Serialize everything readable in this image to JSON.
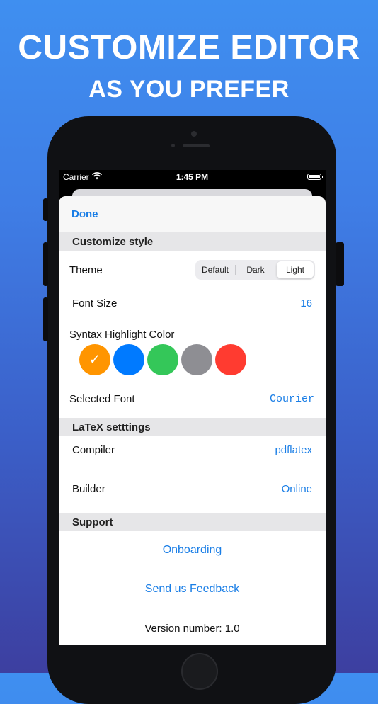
{
  "promo": {
    "headline": "CUSTOMIZE EDITOR",
    "subheadline": "AS YOU PREFER"
  },
  "status_bar": {
    "carrier": "Carrier",
    "time": "1:45 PM",
    "icons": [
      "wifi-icon",
      "battery-icon"
    ]
  },
  "navbar": {
    "done_label": "Done"
  },
  "customize_style": {
    "header": "Customize style",
    "theme": {
      "label": "Theme",
      "options": [
        "Default",
        "Dark",
        "Light"
      ],
      "selected": "Light"
    },
    "font_size": {
      "label": "Font Size",
      "value": "16"
    },
    "syntax_highlight": {
      "label": "Syntax Highlight Color",
      "colors": [
        "#ff9500",
        "#007aff",
        "#34c759",
        "#8e8e93",
        "#ff3b30"
      ],
      "selected_index": 0,
      "check_glyph": "✓"
    },
    "selected_font": {
      "label": "Selected Font",
      "value": "Courier"
    }
  },
  "latex_settings": {
    "header": "LaTeX setttings",
    "compiler": {
      "label": "Compiler",
      "value": "pdflatex"
    },
    "builder": {
      "label": "Builder",
      "value": "Online"
    }
  },
  "support": {
    "header": "Support",
    "onboarding_label": "Onboarding",
    "feedback_label": "Send us Feedback",
    "version_text": "Version number: 1.0"
  },
  "colors": {
    "accent": "#1a7ee6",
    "background_top": "#3f8ff0",
    "background_bottom": "#3d3fa0"
  }
}
